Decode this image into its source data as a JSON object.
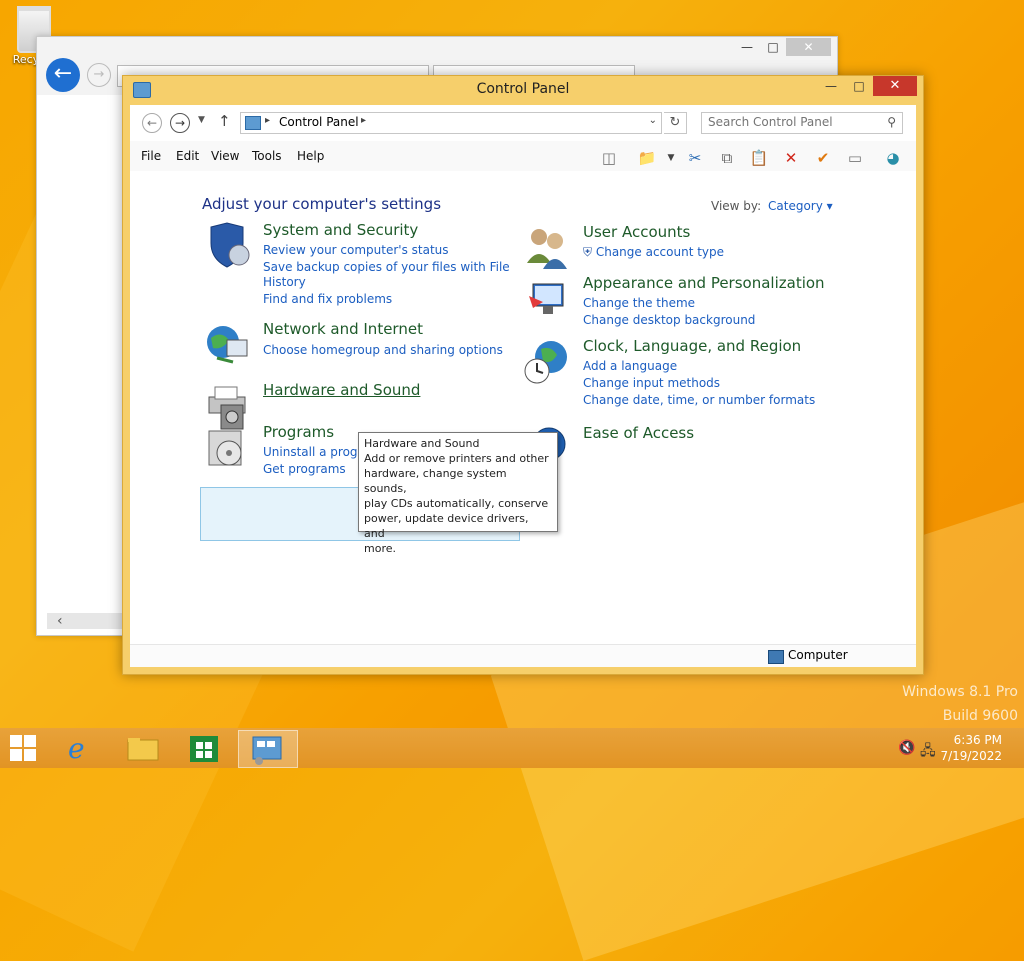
{
  "desktop": {
    "recycle_label": "Recyc",
    "watermark_line1": "Windows 8.1 Pro",
    "watermark_line2": "Build 9600"
  },
  "control_panel": {
    "title": "Control Panel",
    "address": "Control Panel",
    "search_placeholder": "Search Control Panel",
    "menus": [
      "File",
      "Edit",
      "View",
      "Tools",
      "Help"
    ],
    "heading": "Adjust your computer's settings",
    "view_by_label": "View by:",
    "view_by_value": "Category",
    "categories_left": [
      {
        "title": "System and Security",
        "links": [
          "Review your computer's status",
          "Save backup copies of your files with File",
          "History",
          "Find and fix problems"
        ]
      },
      {
        "title": "Network and Internet",
        "links": [
          "Choose homegroup and sharing options"
        ]
      },
      {
        "title": "Hardware and Sound",
        "links": []
      },
      {
        "title": "Programs",
        "links": [
          "Uninstall a program",
          "Get programs"
        ]
      }
    ],
    "categories_right": [
      {
        "title": "User Accounts",
        "links": [
          "Change account type"
        ]
      },
      {
        "title": "Appearance and Personalization",
        "links": [
          "Change the theme",
          "Change desktop background"
        ]
      },
      {
        "title": "Clock, Language, and Region",
        "links": [
          "Add a language",
          "Change input methods",
          "Change date, time, or number formats"
        ]
      },
      {
        "title": "Ease of Access",
        "links": []
      }
    ],
    "tooltip": {
      "title": "Hardware and Sound",
      "lines": [
        "Add or remove printers and other",
        "hardware, change system sounds,",
        "play CDs automatically, conserve",
        "power, update device drivers, and",
        "more."
      ]
    },
    "status_text": "Computer"
  },
  "taskbar": {
    "time": "6:36 PM",
    "date": "7/19/2022"
  }
}
